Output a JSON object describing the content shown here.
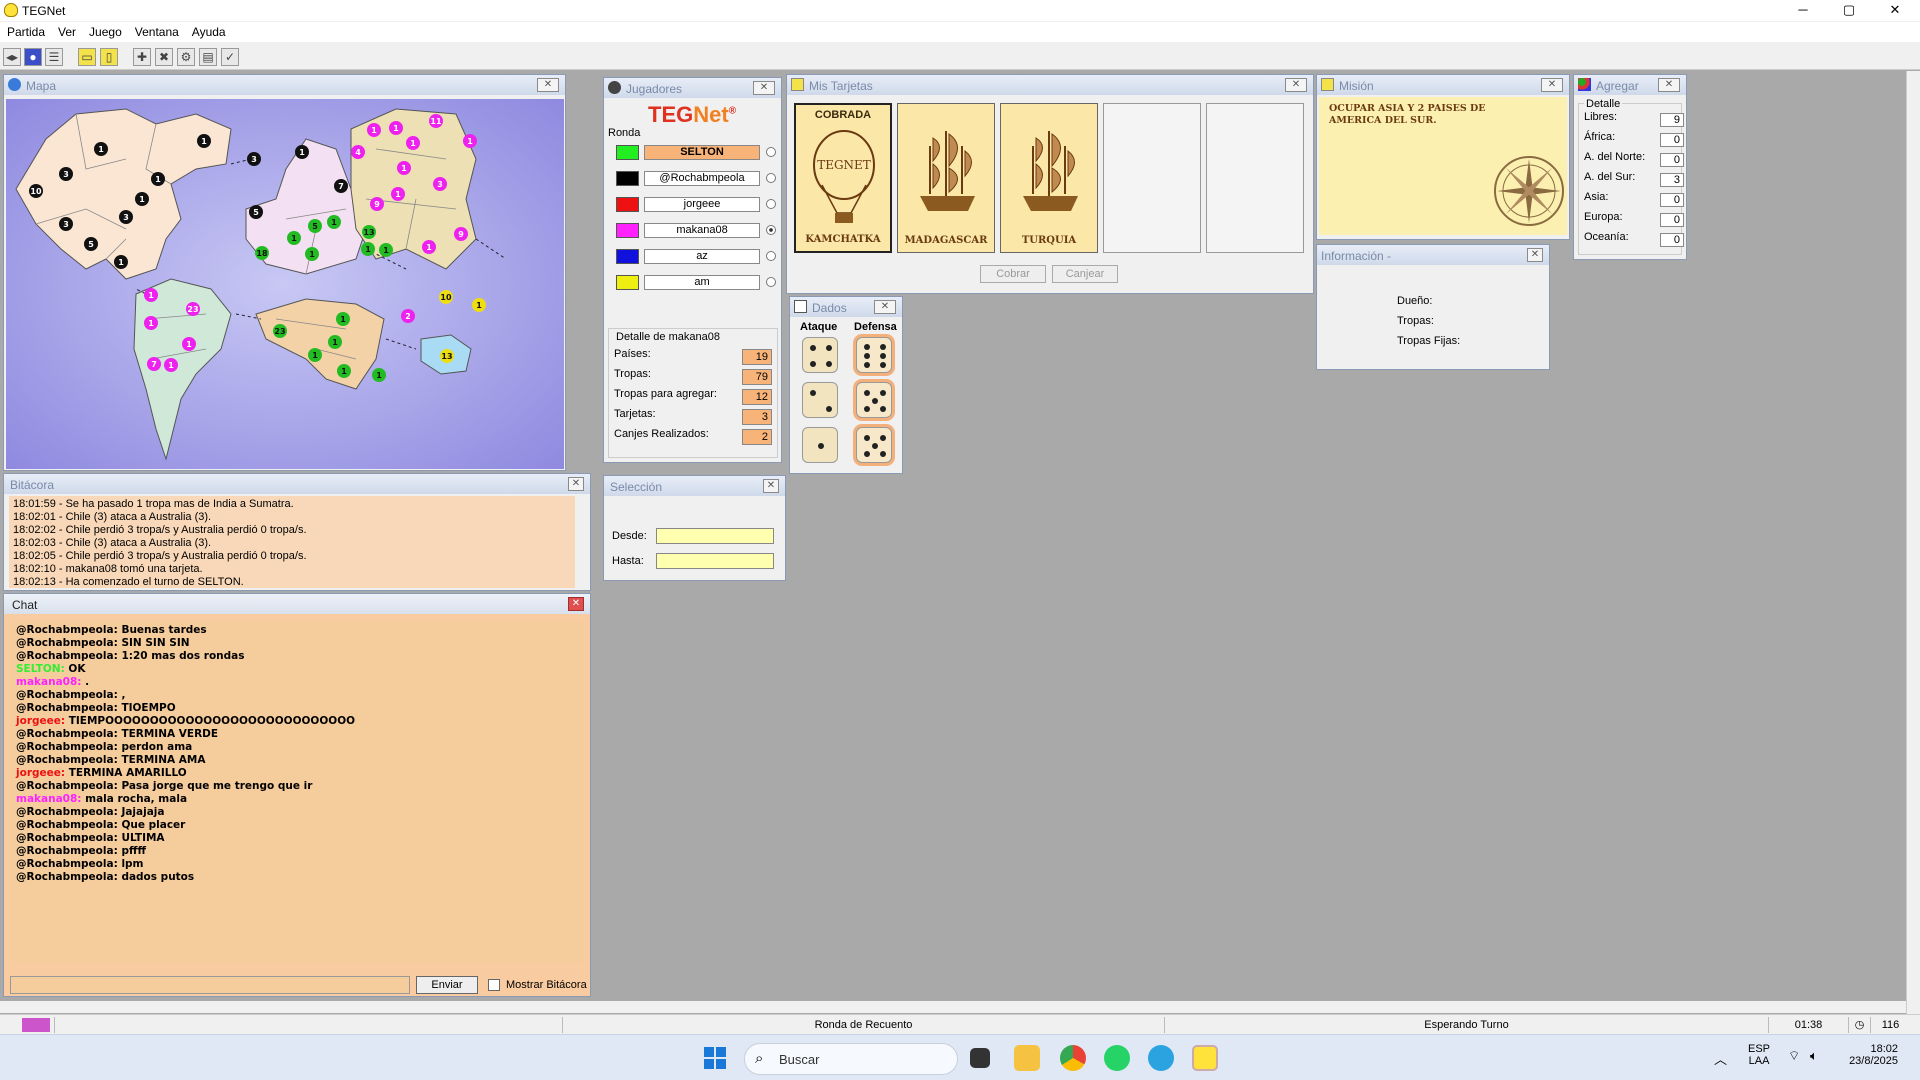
{
  "window": {
    "title": "TEGNet",
    "minimize": "─",
    "maximize": "▢",
    "close": "✕"
  },
  "menu": [
    "Partida",
    "Ver",
    "Juego",
    "Ventana",
    "Ayuda"
  ],
  "map": {
    "title": "Mapa"
  },
  "bitacora": {
    "title": "Bitácora",
    "lines": [
      "18:01:59 - Se ha pasado 1 tropa mas de India a Sumatra.",
      "18:02:01 - Chile (3) ataca a Australia (3).",
      "18:02:02 - Chile perdió 3 tropa/s y Australia perdió 0 tropa/s.",
      "18:02:03 - Chile (3) ataca a Australia (3).",
      "18:02:05 - Chile perdió 3 tropa/s y Australia perdió 0 tropa/s.",
      "18:02:10 - makana08 tomó una tarjeta.",
      "18:02:13 - Ha comenzado el turno de SELTON."
    ]
  },
  "chat": {
    "title": "Chat",
    "send": "Enviar",
    "show_log": "Mostrar Bitácora",
    "messages": [
      {
        "user": "@Rochabmpeola:",
        "text": "Buenas tardes",
        "color": "#000000"
      },
      {
        "user": "@Rochabmpeola:",
        "text": "SIN SIN SIN",
        "color": "#000000"
      },
      {
        "user": "@Rochabmpeola:",
        "text": "1:20 mas dos rondas",
        "color": "#000000"
      },
      {
        "user": "SELTON:",
        "text": "OK",
        "color": "#33ee33"
      },
      {
        "user": "makana08:",
        "text": ".",
        "color": "#ff22ff"
      },
      {
        "user": "@Rochabmpeola:",
        "text": ",",
        "color": "#000000"
      },
      {
        "user": "@Rochabmpeola:",
        "text": "TIOEMPO",
        "color": "#000000"
      },
      {
        "user": "jorgeee:",
        "text": "TIEMPOOOOOOOOOOOOOOOOOOOOOOOOOOOO",
        "color": "#ee1111"
      },
      {
        "user": "@Rochabmpeola:",
        "text": "TERMINA VERDE",
        "color": "#000000"
      },
      {
        "user": "@Rochabmpeola:",
        "text": "perdon ama",
        "color": "#000000"
      },
      {
        "user": "@Rochabmpeola:",
        "text": "TERMINA AMA",
        "color": "#000000"
      },
      {
        "user": "jorgeee:",
        "text": "TERMINA AMARILLO",
        "color": "#ee1111"
      },
      {
        "user": "@Rochabmpeola:",
        "text": "Pasa jorge que me trengo que ir",
        "color": "#000000"
      },
      {
        "user": "makana08:",
        "text": "mala rocha, mala",
        "color": "#ff22ff"
      },
      {
        "user": "@Rochabmpeola:",
        "text": "Jajajaja",
        "color": "#000000"
      },
      {
        "user": "@Rochabmpeola:",
        "text": "Que placer",
        "color": "#000000"
      },
      {
        "user": "@Rochabmpeola:",
        "text": "ULTIMA",
        "color": "#000000"
      },
      {
        "user": "@Rochabmpeola:",
        "text": "pffff",
        "color": "#000000"
      },
      {
        "user": "@Rochabmpeola:",
        "text": "lpm",
        "color": "#000000"
      },
      {
        "user": "@Rochabmpeola:",
        "text": "dados putos",
        "color": "#000000"
      }
    ]
  },
  "jugadores": {
    "title": "Jugadores",
    "logo_a": "TEG",
    "logo_b": "Net",
    "logo_reg": "®",
    "round_label": "Ronda",
    "players": [
      {
        "name": "SELTON",
        "color": "#22ee22",
        "active": true
      },
      {
        "name": "@Rochabmpeola",
        "color": "#000000",
        "active": false
      },
      {
        "name": "jorgeee",
        "color": "#ee1111",
        "active": false
      },
      {
        "name": "makana08",
        "color": "#ff22ff",
        "active": false
      },
      {
        "name": "az",
        "color": "#1111dd",
        "active": false
      },
      {
        "name": "am",
        "color": "#eeee11",
        "active": false
      }
    ],
    "detail_title": "Detalle de makana08",
    "details": [
      {
        "label": "Países:",
        "value": "19"
      },
      {
        "label": "Tropas:",
        "value": "79"
      },
      {
        "label": "Tropas para agregar:",
        "value": "12"
      },
      {
        "label": "Tarjetas:",
        "value": "3"
      },
      {
        "label": "Canjes Realizados:",
        "value": "2"
      }
    ]
  },
  "seleccion": {
    "title": "Selección",
    "desde": "Desde:",
    "hasta": "Hasta:"
  },
  "tarjetas": {
    "title": "Mis Tarjetas",
    "cards": [
      {
        "name": "KAMCHATKA",
        "badge": "COBRADA",
        "emblem": "TEGNET"
      },
      {
        "name": "MADAGASCAR"
      },
      {
        "name": "TURQUIA"
      }
    ],
    "cobrar": "Cobrar",
    "canjear": "Canjear"
  },
  "dados": {
    "title": "Dados",
    "ataque": "Ataque",
    "defensa": "Defensa",
    "attack": [
      4,
      2,
      1
    ],
    "defense": [
      6,
      5,
      5
    ]
  },
  "mision": {
    "title": "Misión",
    "text": "OCUPAR ASIA Y 2 PAISES DE AMERICA DEL SUR."
  },
  "info": {
    "title": "Información -",
    "dueno": "Dueño:",
    "tropas": "Tropas:",
    "fijas": "Tropas Fijas:"
  },
  "agregar": {
    "title": "Agregar",
    "detail": "Detalle",
    "rows": [
      {
        "label": "Libres:",
        "value": "9"
      },
      {
        "label": "África:",
        "value": "0"
      },
      {
        "label": "A. del Norte:",
        "value": "0"
      },
      {
        "label": "A. del Sur:",
        "value": "3"
      },
      {
        "label": "Asia:",
        "value": "0"
      },
      {
        "label": "Europa:",
        "value": "0"
      },
      {
        "label": "Oceanía:",
        "value": "0"
      }
    ]
  },
  "status": {
    "phase": "Ronda de Recuento",
    "state": "Esperando Turno",
    "time": "01:38",
    "count": "116"
  },
  "taskbar": {
    "search": "Buscar",
    "lang1": "ESP",
    "lang2": "LAA",
    "clock": "18:02",
    "date": "23/8/2025"
  },
  "colors": {
    "panel_title": "#7a8aa8",
    "detail_value": "#f8b478",
    "chat_bg": "#f5cc9c"
  }
}
